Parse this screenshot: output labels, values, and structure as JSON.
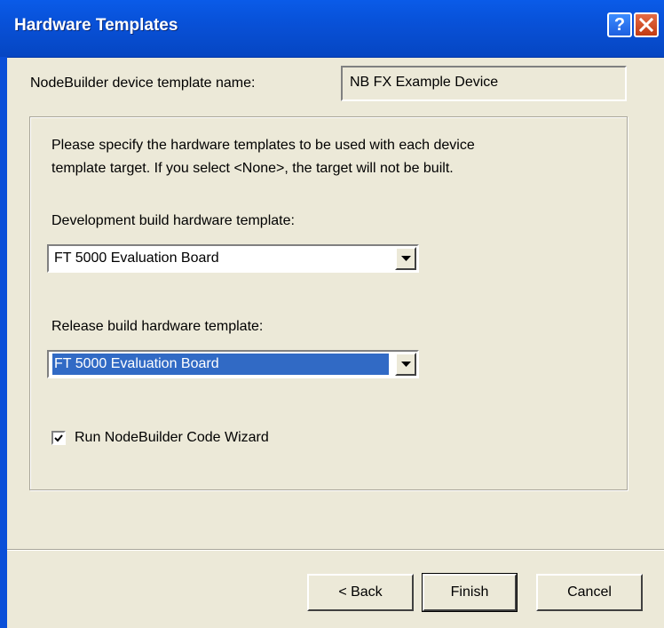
{
  "window": {
    "title": "Hardware Templates",
    "help_glyph": "?"
  },
  "template_name": {
    "label": "NodeBuilder device template name:",
    "value": "NB FX Example Device"
  },
  "instructions": {
    "line1": "Please specify the hardware templates to be used with each device",
    "line2": "template target. If you select <None>, the target will not be built."
  },
  "development": {
    "label": "Development build hardware template:",
    "value": "FT 5000 Evaluation Board"
  },
  "release": {
    "label": "Release build hardware template:",
    "value": "FT 5000 Evaluation Board"
  },
  "code_wizard": {
    "label": "Run NodeBuilder Code Wizard",
    "checked": true
  },
  "buttons": {
    "back": "< Back",
    "finish": "Finish",
    "cancel": "Cancel"
  },
  "colors": {
    "title_bar": "#0A5BE8",
    "dialog_bg": "#ECE9D8",
    "selection": "#316AC5",
    "close": "#C23A12"
  },
  "icons": [
    "help-icon",
    "close-icon",
    "dropdown-arrow-icon",
    "checkmark-icon"
  ]
}
